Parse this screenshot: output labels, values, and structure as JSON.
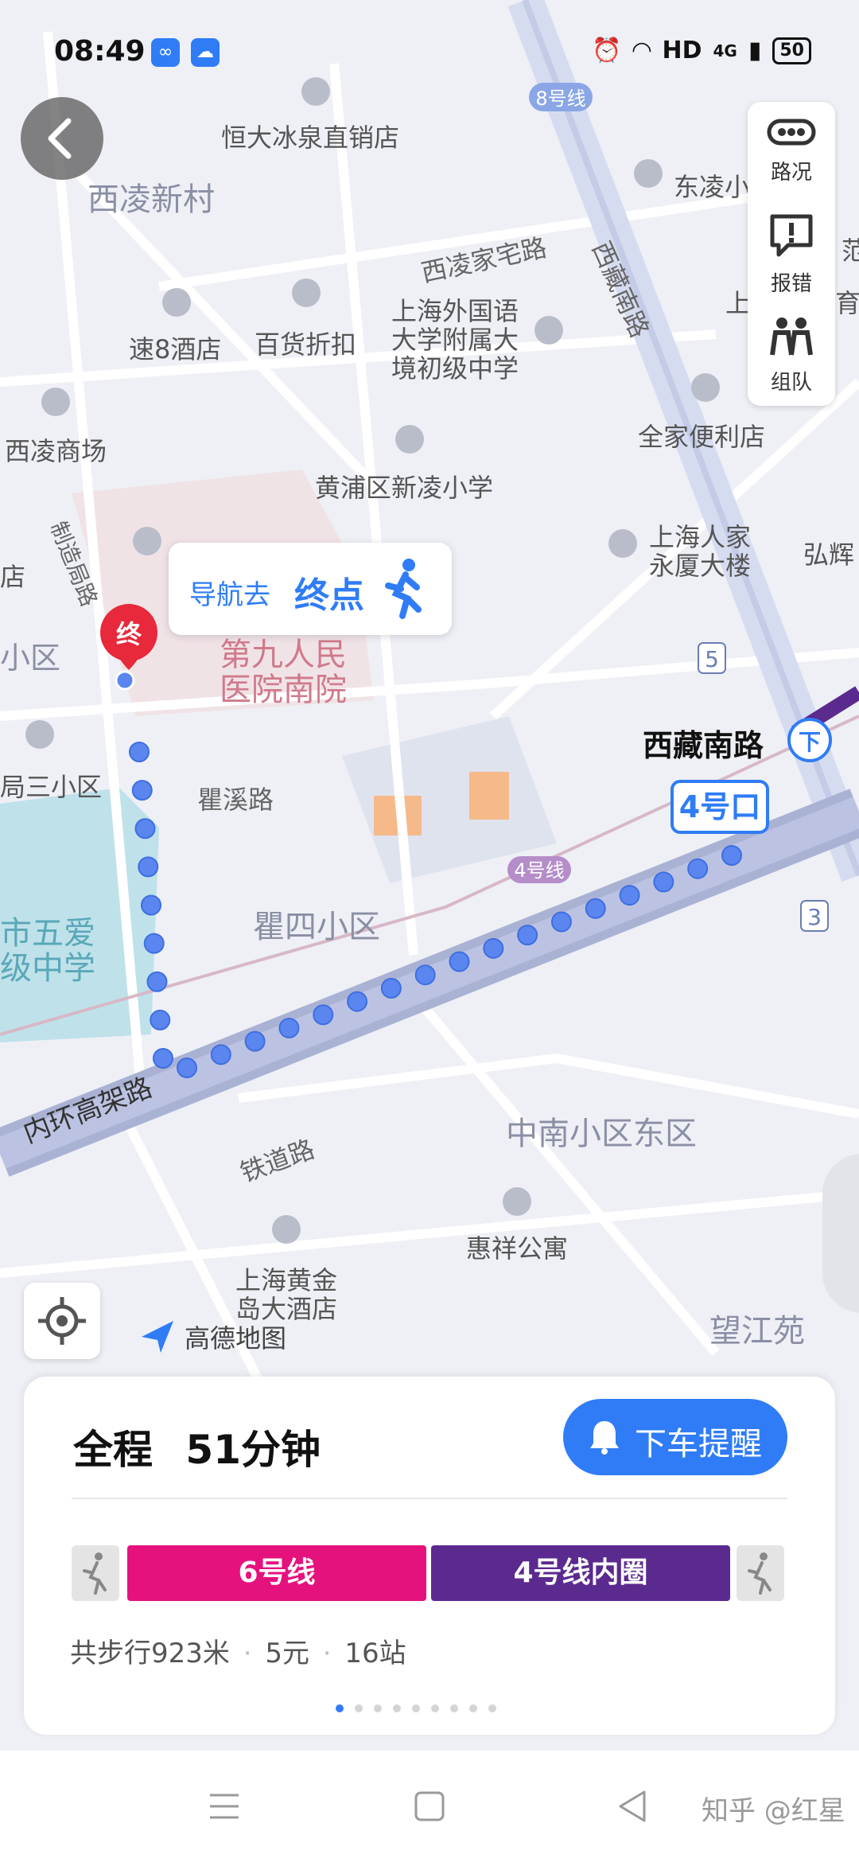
{
  "status_bar": {
    "time": "08:49",
    "network": "HD",
    "signal_type": "4G",
    "battery": "50"
  },
  "map": {
    "labels": {
      "hengda": "恒大冰泉直销店",
      "xiling_village": "西凌新村",
      "xiling_home": "西凌家宅路",
      "metro8": "8号线",
      "xizang_road_v": "西藏南路",
      "dongling": "东凌小",
      "su8": "速8酒店",
      "baihuo": "百货折扣",
      "school1": "上海外国语",
      "school2": "大学附属大",
      "school3": "境初级中学",
      "xiling_mall": "西凌商场",
      "familymart": "全家便利店",
      "huangpu_school": "黄浦区新凌小学",
      "renjia1": "上海人家",
      "renjia2": "永厦大楼",
      "hongtai": "弘辉",
      "zhizao": "制造局路",
      "shop_left": "店",
      "district_left": "小区",
      "hospital1": "第九人民",
      "hospital2": "医院南院",
      "station": "西藏南路",
      "exit": "4号口",
      "exit5": "5",
      "exit3": "3",
      "third_district": "局三小区",
      "quxi": "瞿溪路",
      "metro4": "4号线",
      "qusi": "瞿四小区",
      "wuai1": "市五爱",
      "wuai2": "级中学",
      "ring": "内环高架路",
      "zhongnan": "中南小区东区",
      "tiedao": "铁道路",
      "huixiang": "惠祥公寓",
      "hotel1": "上海黄金",
      "hotel2": "岛大酒店",
      "wangjiang": "望江苑",
      "edge_fan": "范",
      "edge_yu": "育",
      "edge_shang": "上",
      "brand": "高德地图"
    },
    "end_marker": "终",
    "popup": {
      "prefix": "导航去",
      "target": "终点"
    }
  },
  "right_panel": {
    "traffic": "路况",
    "report": "报错",
    "team": "组队"
  },
  "route_card": {
    "total_label": "全程",
    "duration": "51分钟",
    "remind_button": "下车提醒",
    "segments": [
      {
        "label": "6号线",
        "color": "#e5127d"
      },
      {
        "label": "4号线内圈",
        "color": "#5b2a8f"
      }
    ],
    "walk_total": "共步行923米",
    "fare": "5元",
    "stops": "16站",
    "page_count": 9,
    "active_page": 1
  },
  "watermark": "知乎 @红星",
  "colors": {
    "accent": "#2f7cf6",
    "route_dot": "#5b86f0",
    "end_marker": "#e8283b"
  }
}
